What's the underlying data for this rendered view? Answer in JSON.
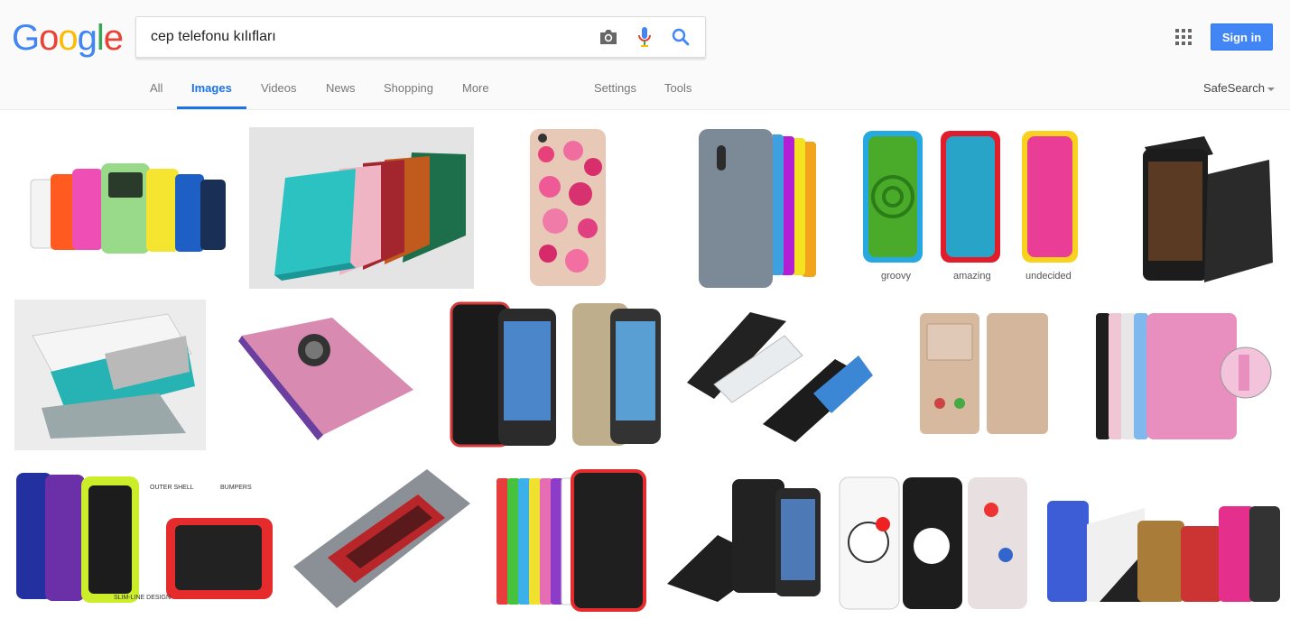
{
  "logo": {
    "letters": [
      "G",
      "o",
      "o",
      "g",
      "l",
      "e"
    ],
    "colors": [
      "#4285f4",
      "#ea4335",
      "#fbbc05",
      "#4285f4",
      "#34a853",
      "#ea4335"
    ]
  },
  "search": {
    "query": "cep telefonu kılıfları",
    "icons": [
      "camera-icon",
      "microphone-icon",
      "search-icon"
    ]
  },
  "header": {
    "signin_label": "Sign in",
    "apps_icon": "apps-grid-icon"
  },
  "tabs": [
    {
      "label": "All"
    },
    {
      "label": "Images",
      "active": true
    },
    {
      "label": "Videos"
    },
    {
      "label": "News"
    },
    {
      "label": "Shopping"
    },
    {
      "label": "More"
    },
    {
      "label": "Settings"
    },
    {
      "label": "Tools"
    }
  ],
  "safesearch_label": "SafeSearch",
  "colors": {
    "accent": "#1a73e8",
    "signin_bg": "#4285f4",
    "header_bg": "#fafafa"
  },
  "images": {
    "row1": [
      {
        "depicts": "colorful flip phone cases"
      },
      {
        "depicts": "leather folio cases fanned"
      },
      {
        "depicts": "pink rhinestone case"
      },
      {
        "depicts": "gray and rainbow cases"
      },
      {
        "depicts": "maze pattern cases",
        "captions": [
          "groovy",
          "amazing",
          "undecided"
        ]
      },
      {
        "depicts": "black flip leather case"
      }
    ],
    "row2": [
      {
        "depicts": "white and teal stand case"
      },
      {
        "depicts": "pink floral rotating tablet case"
      },
      {
        "depicts": "black rugged phone cases"
      },
      {
        "depicts": "black flip cover phones"
      },
      {
        "depicts": "gold window flip case"
      },
      {
        "depicts": "pink flip case close-up"
      }
    ],
    "row3": [
      {
        "depicts": "colored bumper cases with labels",
        "labels": [
          "OUTER SHELL",
          "BUMPERS",
          "SLIM-LINE DESIGN"
        ]
      },
      {
        "depicts": "london telephone booth case"
      },
      {
        "depicts": "rugged kickstand cases"
      },
      {
        "depicts": "black armor cases with kickstand"
      },
      {
        "depicts": "hello kitty cases"
      },
      {
        "depicts": "glitter and leopard cases"
      }
    ]
  }
}
